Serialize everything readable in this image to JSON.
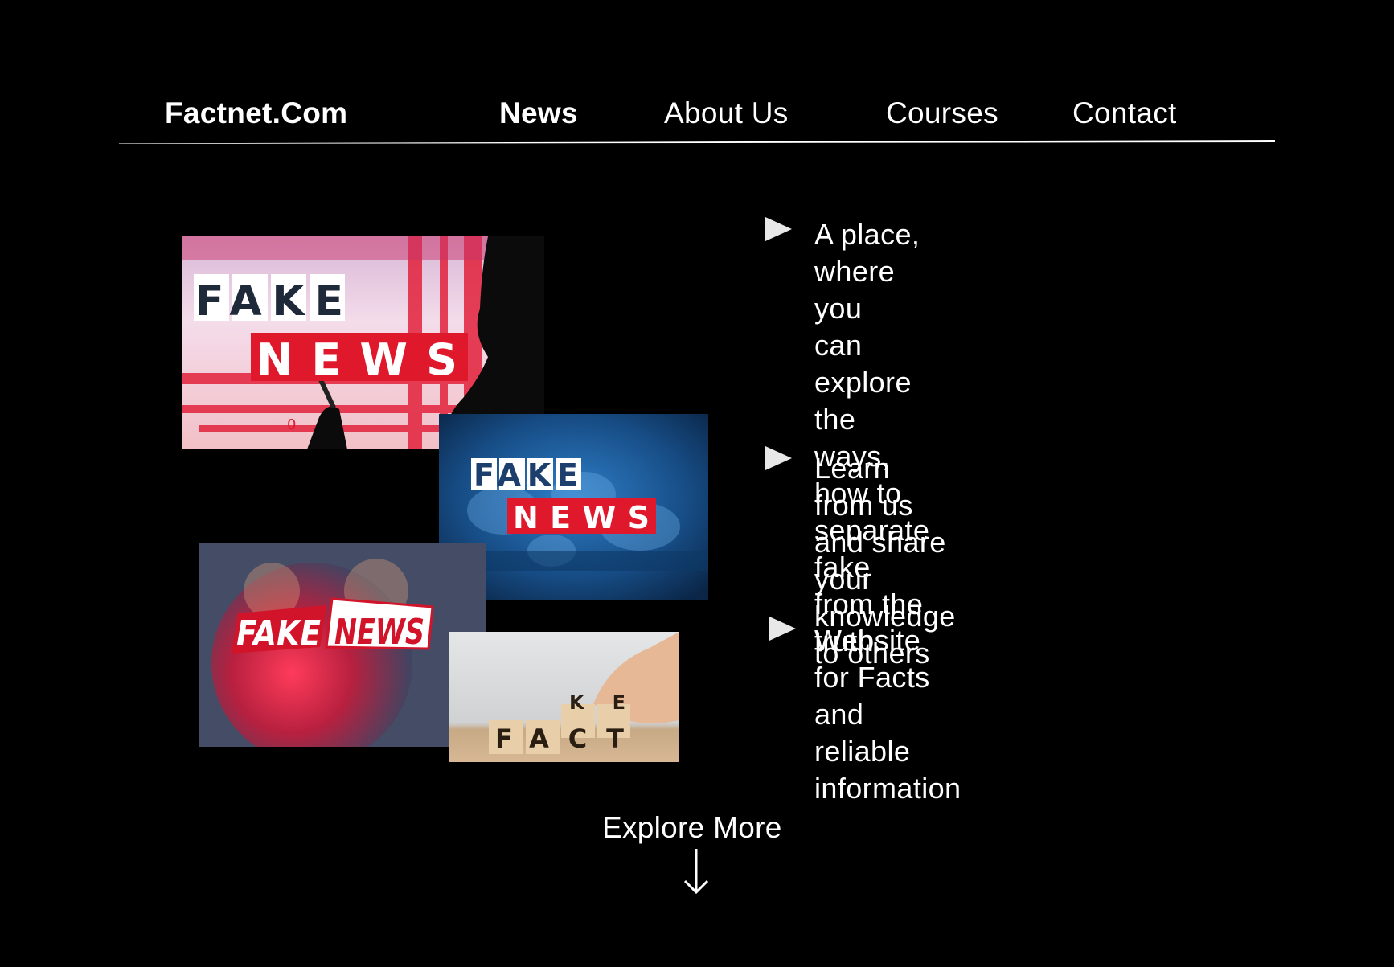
{
  "nav": {
    "brand": "Factnet.Com",
    "items": [
      {
        "label": "News",
        "active": true
      },
      {
        "label": "About Us",
        "active": false
      },
      {
        "label": "Courses",
        "active": false
      },
      {
        "label": "Contact",
        "active": false
      }
    ]
  },
  "images": {
    "img1": {
      "word1": "FAKE",
      "word2": "NEWS",
      "ticker": "0"
    },
    "img2": {
      "word1": "FAKE",
      "word2": "NEWS"
    },
    "img3": {
      "word1": "FAKE",
      "word2": "NEWS"
    },
    "img4": {
      "blocks": "FACT",
      "flipped": "KE"
    }
  },
  "bullets": [
    {
      "text": "A place, where you\ncan explore the ways,\nhow to separate fake\nfrom the truth."
    },
    {
      "text": "Learn from us and share your\nknowledge to others"
    },
    {
      "text": "Website for Facts and\nreliable information"
    }
  ],
  "explore": {
    "label": "Explore More"
  },
  "colors": {
    "background": "#000000",
    "text": "#ffffff",
    "accent_red": "#e0182b",
    "bullet": "#e8e8e8"
  },
  "icons": {
    "bullet": "play-triangle-icon",
    "explore": "arrow-down-icon"
  }
}
